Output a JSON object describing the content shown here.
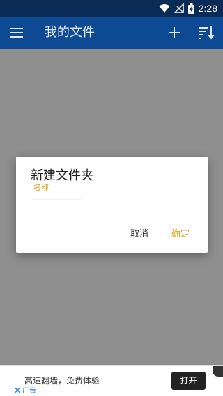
{
  "status_bar": {
    "time": "2:28",
    "icons": [
      "wifi-icon",
      "signal-off-icon",
      "battery-charging-icon"
    ]
  },
  "app_bar": {
    "title": "我的文件",
    "background": "#0e4a93",
    "icons": [
      "menu-icon",
      "add-icon",
      "sort-icon"
    ]
  },
  "dialog": {
    "title": "新建文件夹",
    "field_label": "名称",
    "field_value": "",
    "cancel_label": "取消",
    "ok_label": "确定",
    "accent": "#e2a21b"
  },
  "ad": {
    "text": "高速翻墙，免费体验",
    "button_label": "打开",
    "tag": "广告",
    "close_icon": "close-icon"
  }
}
